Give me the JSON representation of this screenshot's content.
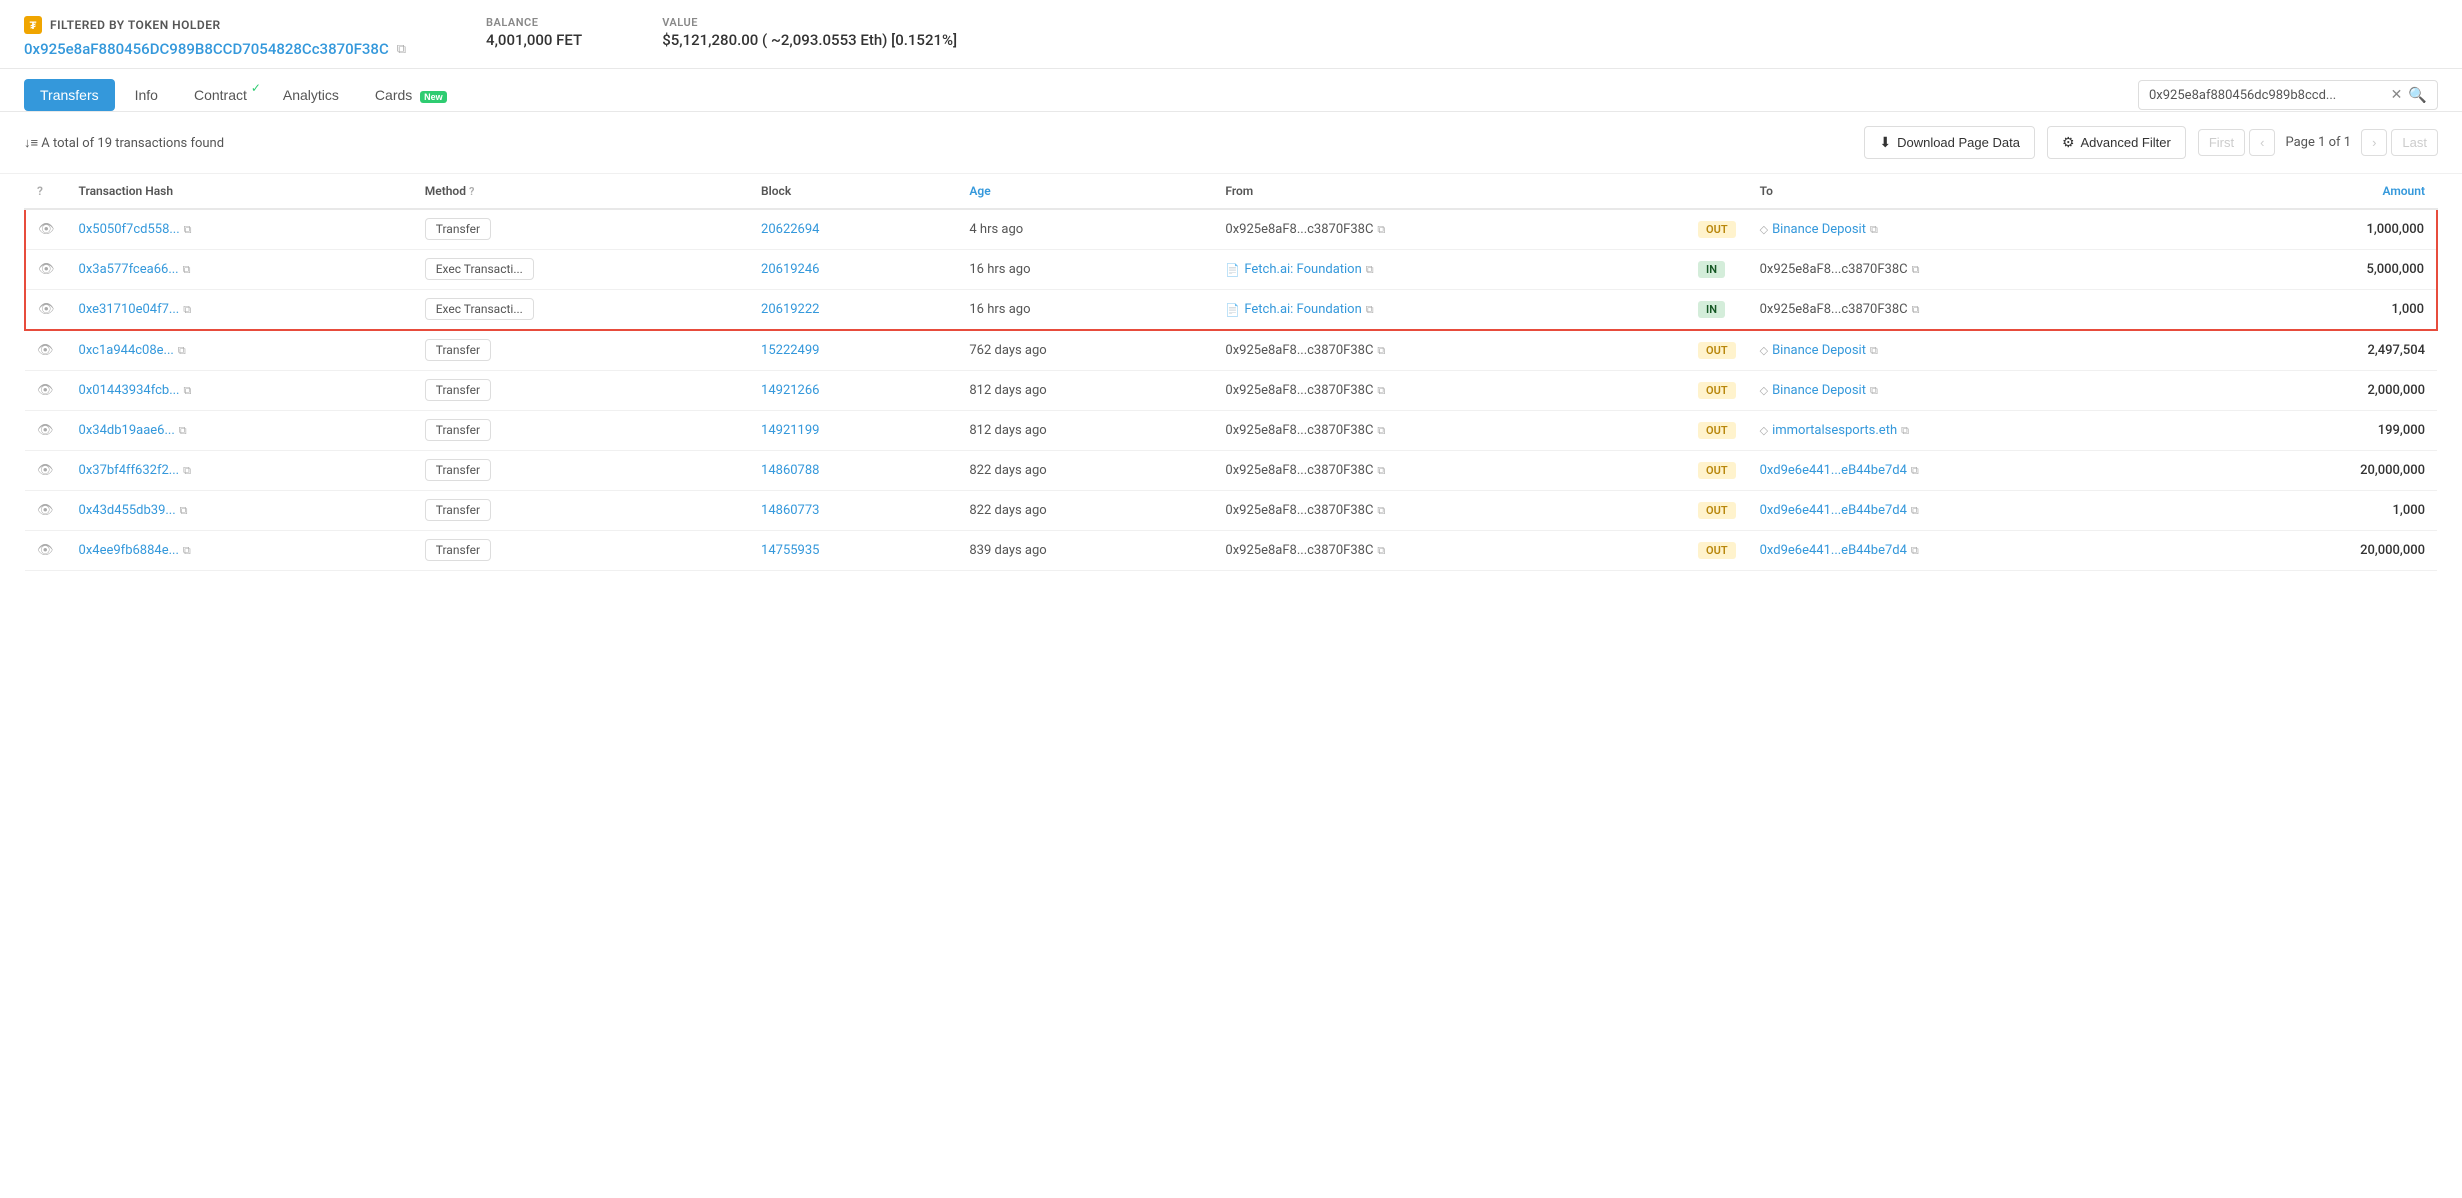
{
  "header": {
    "filtered_label": "FILTERED BY TOKEN HOLDER",
    "address": "0x925e8aF880456DC989B8CCD7054828Cc3870F38C",
    "address_short": "0x925e8aF880456DC989B8CCD7054828Cc3870F38C",
    "copy_icon": "⧉",
    "balance_label": "BALANCE",
    "balance_value": "4,001,000 FET",
    "value_label": "VALUE",
    "value_value": "$5,121,280.00 ( ~2,093.0553 Eth) [0.1521%]"
  },
  "tabs": [
    {
      "id": "transfers",
      "label": "Transfers",
      "active": true,
      "badge": null,
      "check": false
    },
    {
      "id": "info",
      "label": "Info",
      "active": false,
      "badge": null,
      "check": false
    },
    {
      "id": "contract",
      "label": "Contract",
      "active": false,
      "badge": null,
      "check": true
    },
    {
      "id": "analytics",
      "label": "Analytics",
      "active": false,
      "badge": null,
      "check": false
    },
    {
      "id": "cards",
      "label": "Cards",
      "active": false,
      "badge": "New",
      "check": false
    }
  ],
  "search": {
    "value": "0x925e8af880456dc989b8ccd...",
    "placeholder": "Search"
  },
  "toolbar": {
    "total_text": "↓≡ A total of 19 transactions found",
    "download_label": "Download Page Data",
    "filter_label": "Advanced Filter",
    "page_text": "Page 1 of 1",
    "first_label": "First",
    "prev_label": "‹",
    "next_label": "›",
    "last_label": "Last"
  },
  "table": {
    "columns": [
      {
        "id": "eye",
        "label": ""
      },
      {
        "id": "hash",
        "label": "Transaction Hash"
      },
      {
        "id": "method",
        "label": "Method ?"
      },
      {
        "id": "block",
        "label": "Block"
      },
      {
        "id": "age",
        "label": "Age",
        "blue": true
      },
      {
        "id": "from",
        "label": "From"
      },
      {
        "id": "direction",
        "label": ""
      },
      {
        "id": "to",
        "label": "To"
      },
      {
        "id": "amount",
        "label": "Amount",
        "blue": true
      }
    ],
    "rows": [
      {
        "eye": "👁",
        "hash": "0x5050f7cd558...",
        "method": "Transfer",
        "block": "20622694",
        "age": "4 hrs ago",
        "from": "0x925e8aF8...c3870F38C",
        "direction": "OUT",
        "to": "Binance Deposit",
        "to_type": "named",
        "amount": "1,000,000",
        "highlighted": true
      },
      {
        "eye": "👁",
        "hash": "0x3a577fcea66...",
        "method": "Exec Transacti...",
        "block": "20619246",
        "age": "16 hrs ago",
        "from": "Fetch.ai: Foundation",
        "from_type": "named",
        "direction": "IN",
        "to": "0x925e8aF8...c3870F38C",
        "amount": "5,000,000",
        "highlighted": true
      },
      {
        "eye": "👁",
        "hash": "0xe31710e04f7...",
        "method": "Exec Transacti...",
        "block": "20619222",
        "age": "16 hrs ago",
        "from": "Fetch.ai: Foundation",
        "from_type": "named",
        "direction": "IN",
        "to": "0x925e8aF8...c3870F38C",
        "amount": "1,000",
        "highlighted": true
      },
      {
        "eye": "👁",
        "hash": "0xc1a944c08e...",
        "method": "Transfer",
        "block": "15222499",
        "age": "762 days ago",
        "from": "0x925e8aF8...c3870F38C",
        "direction": "OUT",
        "to": "Binance Deposit",
        "to_type": "named",
        "amount": "2,497,504",
        "highlighted": false
      },
      {
        "eye": "👁",
        "hash": "0x01443934fcb...",
        "method": "Transfer",
        "block": "14921266",
        "age": "812 days ago",
        "from": "0x925e8aF8...c3870F38C",
        "direction": "OUT",
        "to": "Binance Deposit",
        "to_type": "named",
        "amount": "2,000,000",
        "highlighted": false
      },
      {
        "eye": "👁",
        "hash": "0x34db19aae6...",
        "method": "Transfer",
        "block": "14921199",
        "age": "812 days ago",
        "from": "0x925e8aF8...c3870F38C",
        "direction": "OUT",
        "to": "immortalsesports.eth",
        "to_type": "ens",
        "amount": "199,000",
        "highlighted": false
      },
      {
        "eye": "👁",
        "hash": "0x37bf4ff632f2...",
        "method": "Transfer",
        "block": "14860788",
        "age": "822 days ago",
        "from": "0x925e8aF8...c3870F38C",
        "direction": "OUT",
        "to": "0xd9e6e441...eB44be7d4",
        "to_type": "address",
        "amount": "20,000,000",
        "highlighted": false
      },
      {
        "eye": "👁",
        "hash": "0x43d455db39...",
        "method": "Transfer",
        "block": "14860773",
        "age": "822 days ago",
        "from": "0x925e8aF8...c3870F38C",
        "direction": "OUT",
        "to": "0xd9e6e441...eB44be7d4",
        "to_type": "address",
        "amount": "1,000",
        "highlighted": false
      },
      {
        "eye": "👁",
        "hash": "0x4ee9fb6884e...",
        "method": "Transfer",
        "block": "14755935",
        "age": "839 days ago",
        "from": "0x925e8aF8...c3870F38C",
        "direction": "OUT",
        "to": "0xd9e6e441...eB44be7d4",
        "to_type": "address",
        "amount": "20,000,000",
        "highlighted": false
      }
    ]
  },
  "colors": {
    "accent_blue": "#3498db",
    "out_bg": "#fff3cd",
    "out_text": "#b8860b",
    "in_bg": "#d4edda",
    "in_text": "#155724",
    "highlight_border": "#e74c3c"
  }
}
